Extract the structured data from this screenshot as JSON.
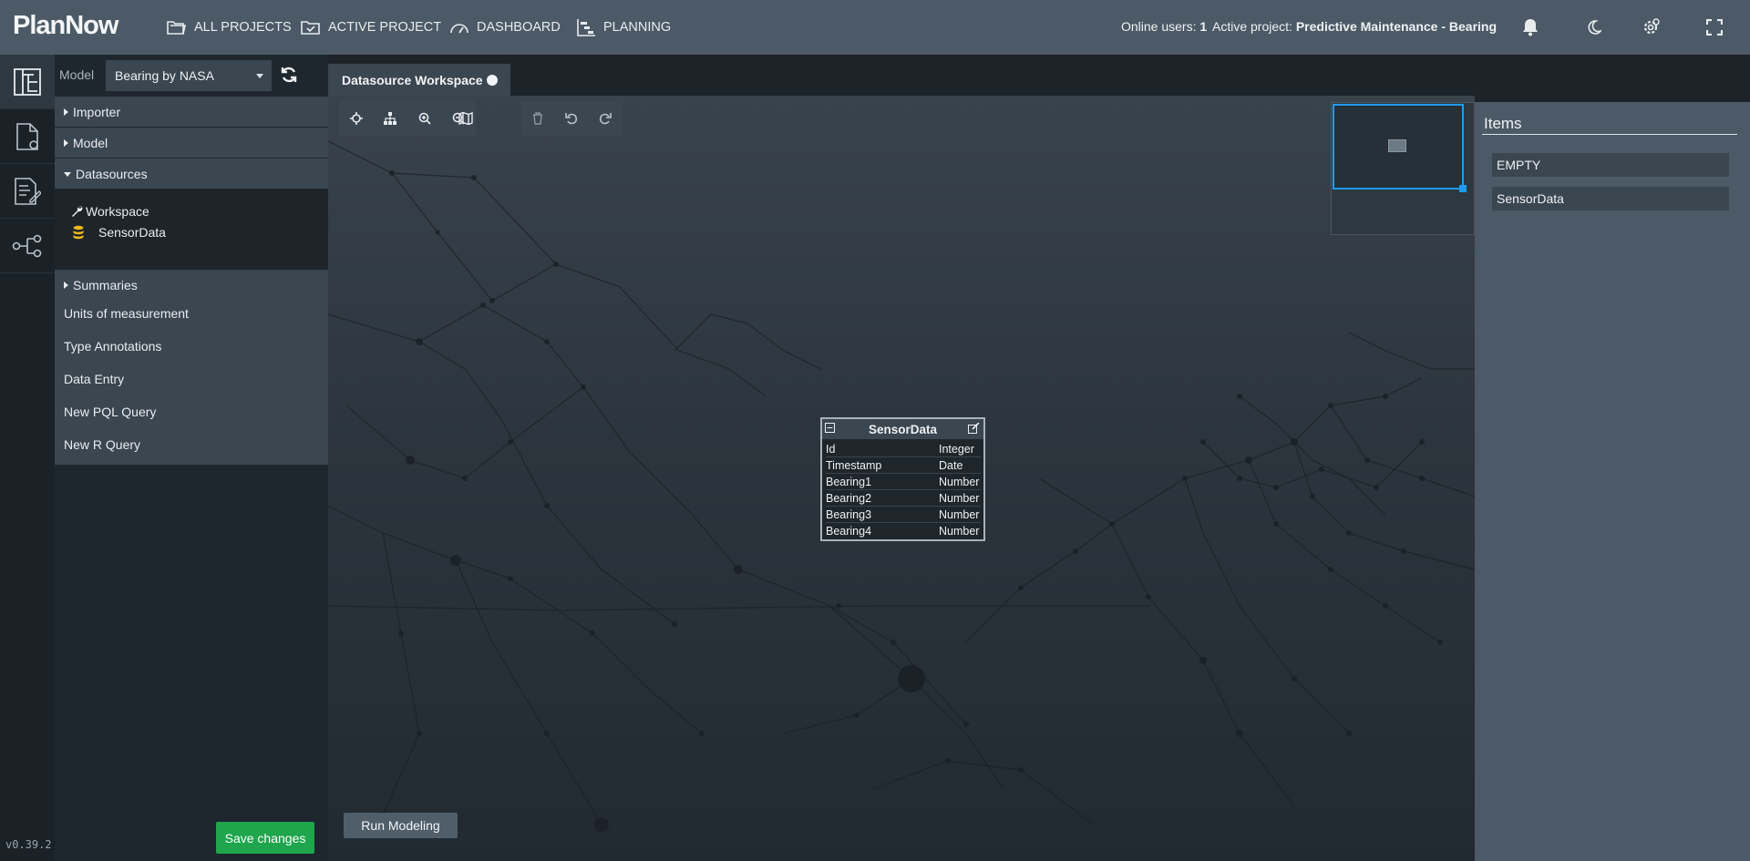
{
  "app": {
    "brand": "PlanNow",
    "version": "v0.39.2"
  },
  "nav": {
    "all_projects": "ALL PROJECTS",
    "active_project": "ACTIVE PROJECT",
    "dashboard": "DASHBOARD",
    "planning": "PLANNING"
  },
  "status": {
    "online_users_label": "Online users:",
    "online_users_value": "1",
    "active_project_label": "Active project:",
    "active_project_value": "Predictive Maintenance - Bearing"
  },
  "sidebar": {
    "model_label": "Model",
    "model_selected": "Bearing by NASA",
    "tree": {
      "importer": "Importer",
      "model": "Model",
      "datasources": "Datasources",
      "workspace": "Workspace",
      "sensordata": "SensorData",
      "summaries": "Summaries"
    },
    "items": [
      "Units of measurement",
      "Type Annotations",
      "Data Entry",
      "New PQL Query",
      "New R Query"
    ],
    "save_label": "Save changes"
  },
  "workspace": {
    "tab_label": "Datasource Workspace",
    "run_label": "Run Modeling"
  },
  "node": {
    "title": "SensorData",
    "fields": [
      {
        "name": "Id",
        "type": "Integer"
      },
      {
        "name": "Timestamp",
        "type": "Date"
      },
      {
        "name": "Bearing1",
        "type": "Number"
      },
      {
        "name": "Bearing2",
        "type": "Number"
      },
      {
        "name": "Bearing3",
        "type": "Number"
      },
      {
        "name": "Bearing4",
        "type": "Number"
      }
    ]
  },
  "items_panel": {
    "title": "Items",
    "entries": [
      "EMPTY",
      "SensorData"
    ]
  },
  "colors": {
    "accent": "#1e9bf0",
    "save": "#1fa54c",
    "topbar": "#4b5a66"
  }
}
